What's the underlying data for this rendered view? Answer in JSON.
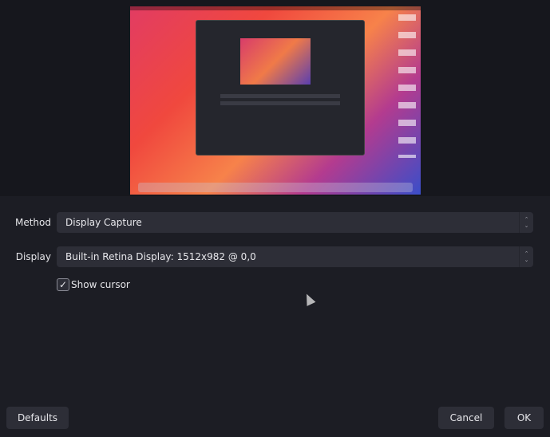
{
  "preview": {
    "description_icon": "display-capture-preview"
  },
  "method": {
    "label": "Method",
    "value": "Display Capture"
  },
  "display": {
    "label": "Display",
    "value": "Built-in Retina Display: 1512x982 @ 0,0"
  },
  "show_cursor": {
    "label": "Show cursor",
    "checked": true,
    "check_glyph": "✓"
  },
  "buttons": {
    "defaults": "Defaults",
    "cancel": "Cancel",
    "ok": "OK"
  },
  "spin_glyphs": {
    "up": "⌃",
    "down": "⌄"
  }
}
